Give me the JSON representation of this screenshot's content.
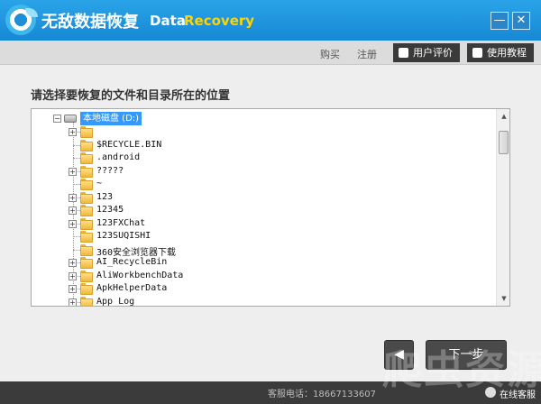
{
  "titlebar": {
    "app_title": "无敌数据恢复",
    "brand_part1": "Data",
    "brand_part2": "Recovery",
    "brand_colors": {
      "part1": "#ffffff",
      "part2": "#ffd400",
      "bar": "#1f95dd"
    },
    "minimize_label": "—",
    "close_label": "✕"
  },
  "topnav": {
    "buy": "购买",
    "register": "注册",
    "user_review": "用户评价",
    "tutorial": "使用教程",
    "review_icon": "thumbs-up-icon",
    "tutorial_icon": "help-icon"
  },
  "instruction": "请选择要恢复的文件和目录所在的位置",
  "tree": {
    "root": {
      "label": "本地磁盘 (D:)",
      "icon": "drive-icon",
      "expander": "−"
    },
    "items": [
      {
        "label": "",
        "expander": "+"
      },
      {
        "label": "$RECYCLE.BIN",
        "expander": ""
      },
      {
        "label": ".android",
        "expander": ""
      },
      {
        "label": "?????",
        "expander": "+"
      },
      {
        "label": "~",
        "expander": ""
      },
      {
        "label": "123",
        "expander": "+"
      },
      {
        "label": "12345",
        "expander": "+"
      },
      {
        "label": "123FXChat",
        "expander": "+"
      },
      {
        "label": "123SUQISHI",
        "expander": ""
      },
      {
        "label": "360安全浏览器下载",
        "expander": ""
      },
      {
        "label": "AI_RecycleBin",
        "expander": "+"
      },
      {
        "label": "AliWorkbenchData",
        "expander": "+"
      },
      {
        "label": "ApkHelperData",
        "expander": "+"
      },
      {
        "label": "App_Log",
        "expander": "+"
      }
    ]
  },
  "buttons": {
    "back": "◀",
    "next": "下一步"
  },
  "statusbar": {
    "hotline": "客服电话：18667133607",
    "online": "在线客服"
  },
  "watermark": "爬虫资源"
}
